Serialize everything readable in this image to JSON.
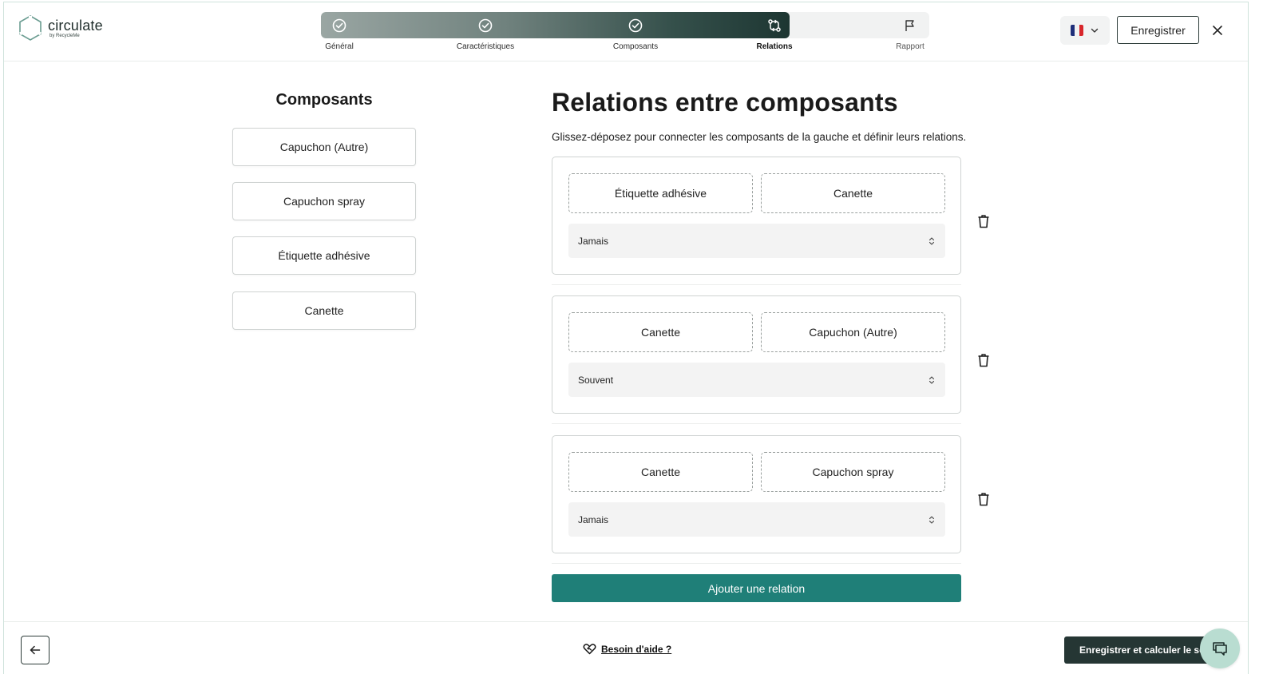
{
  "brand": {
    "name": "circulate",
    "sub": "by RecycleMe"
  },
  "stepper": {
    "progress": 0.77,
    "steps": [
      {
        "label": "Général",
        "state": "done",
        "icon": "check-circle-icon"
      },
      {
        "label": "Caractéristiques",
        "state": "done",
        "icon": "check-circle-icon"
      },
      {
        "label": "Composants",
        "state": "done",
        "icon": "check-circle-icon"
      },
      {
        "label": "Relations",
        "state": "active",
        "icon": "relations-icon"
      },
      {
        "label": "Rapport",
        "state": "future",
        "icon": "flag-icon"
      }
    ]
  },
  "header": {
    "language": {
      "flag_colors": [
        "#1f2f7a",
        "#f2f2f2",
        "#d8262b"
      ],
      "icon": "chevron-down-icon"
    },
    "save_label": "Enregistrer",
    "close_icon": "close-icon"
  },
  "components": {
    "title": "Composants",
    "items": [
      "Capuchon (Autre)",
      "Capuchon spray",
      "Étiquette adhésive",
      "Canette"
    ]
  },
  "relations": {
    "title": "Relations entre composants",
    "description": "Glissez-déposez pour connecter les composants de la gauche et définir leurs relations.",
    "items": [
      {
        "a": "Étiquette adhésive",
        "b": "Canette",
        "frequency": "Jamais"
      },
      {
        "a": "Canette",
        "b": "Capuchon (Autre)",
        "frequency": "Souvent"
      },
      {
        "a": "Canette",
        "b": "Capuchon spray",
        "frequency": "Jamais"
      }
    ],
    "add_label": "Ajouter une relation"
  },
  "footer": {
    "help_label": "Besoin d'aide ?",
    "calc_label": "Enregistrer et calculer le score"
  },
  "colors": {
    "accent": "#1f7f78",
    "dark": "#253634",
    "chat": "#b9ddd1"
  }
}
